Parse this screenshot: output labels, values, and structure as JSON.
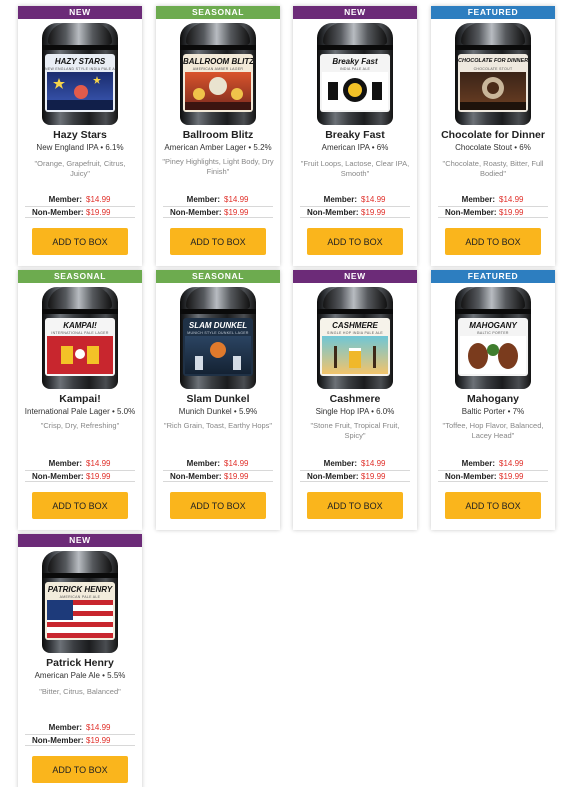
{
  "prices": {
    "member_label": "Member:",
    "nonmember_label": "Non-Member:",
    "member_value": "$14.99",
    "nonmember_value": "$19.99"
  },
  "button_label": "ADD TO BOX",
  "colors": {
    "badge_new": "#6c2b78",
    "badge_seasonal": "#6dab4f",
    "badge_featured": "#2d7ec0",
    "button": "#fab51c",
    "price": "#e0312b"
  },
  "products": [
    {
      "badge": "NEW",
      "badge_type": "new",
      "can_label": "HAZY STARS",
      "can_sub": "NEW ENGLAND STYLE INDIA PALE ALE",
      "name": "Hazy Stars",
      "style": "New England IPA • 6.1%",
      "notes": "\"Orange, Grapefruit, Citrus, Juicy\""
    },
    {
      "badge": "SEASONAL",
      "badge_type": "seasonal",
      "can_label": "BALLROOM BLITZ",
      "can_sub": "AMERICAN AMBER LAGER",
      "name": "Ballroom Blitz",
      "style": "American Amber Lager • 5.2%",
      "notes": "\"Piney Highlights, Light Body, Dry Finish\""
    },
    {
      "badge": "NEW",
      "badge_type": "new",
      "can_label": "Breaky Fast",
      "can_sub": "INDIA PALE ALE",
      "name": "Breaky Fast",
      "style": "American IPA • 6%",
      "notes": "\"Fruit Loops, Lactose, Clear IPA, Smooth\""
    },
    {
      "badge": "FEATURED",
      "badge_type": "featured",
      "can_label": "CHOCOLATE FOR DINNER",
      "can_sub": "CHOCOLATE STOUT",
      "name": "Chocolate for Dinner",
      "style": "Chocolate Stout • 6%",
      "notes": "\"Chocolate, Roasty, Bitter, Full Bodied\""
    },
    {
      "badge": "SEASONAL",
      "badge_type": "seasonal",
      "can_label": "KAMPAI!",
      "can_sub": "INTERNATIONAL PALE LAGER",
      "name": "Kampai!",
      "style": "International Pale Lager • 5.0%",
      "notes": "\"Crisp, Dry, Refreshing\""
    },
    {
      "badge": "SEASONAL",
      "badge_type": "seasonal",
      "can_label": "SLAM DUNKEL",
      "can_sub": "MUNICH STYLE DUNKEL LAGER",
      "name": "Slam Dunkel",
      "style": "Munich Dunkel • 5.9%",
      "notes": "\"Rich Grain, Toast, Earthy Hops\""
    },
    {
      "badge": "NEW",
      "badge_type": "new",
      "can_label": "CASHMERE",
      "can_sub": "SINGLE HOP INDIA PALE ALE",
      "name": "Cashmere",
      "style": "Single Hop IPA • 6.0%",
      "notes": "\"Stone Fruit, Tropical Fruit, Spicy\""
    },
    {
      "badge": "FEATURED",
      "badge_type": "featured",
      "can_label": "MAHOGANY",
      "can_sub": "BALTIC PORTER",
      "name": "Mahogany",
      "style": "Baltic Porter • 7%",
      "notes": "\"Toffee, Hop Flavor, Balanced, Lacey Head\""
    },
    {
      "badge": "NEW",
      "badge_type": "new",
      "can_label": "PATRICK HENRY",
      "can_sub": "AMERICAN PALE ALE",
      "name": "Patrick Henry",
      "style": "American Pale Ale • 5.5%",
      "notes": "\"Bitter, Citrus, Balanced\""
    }
  ]
}
